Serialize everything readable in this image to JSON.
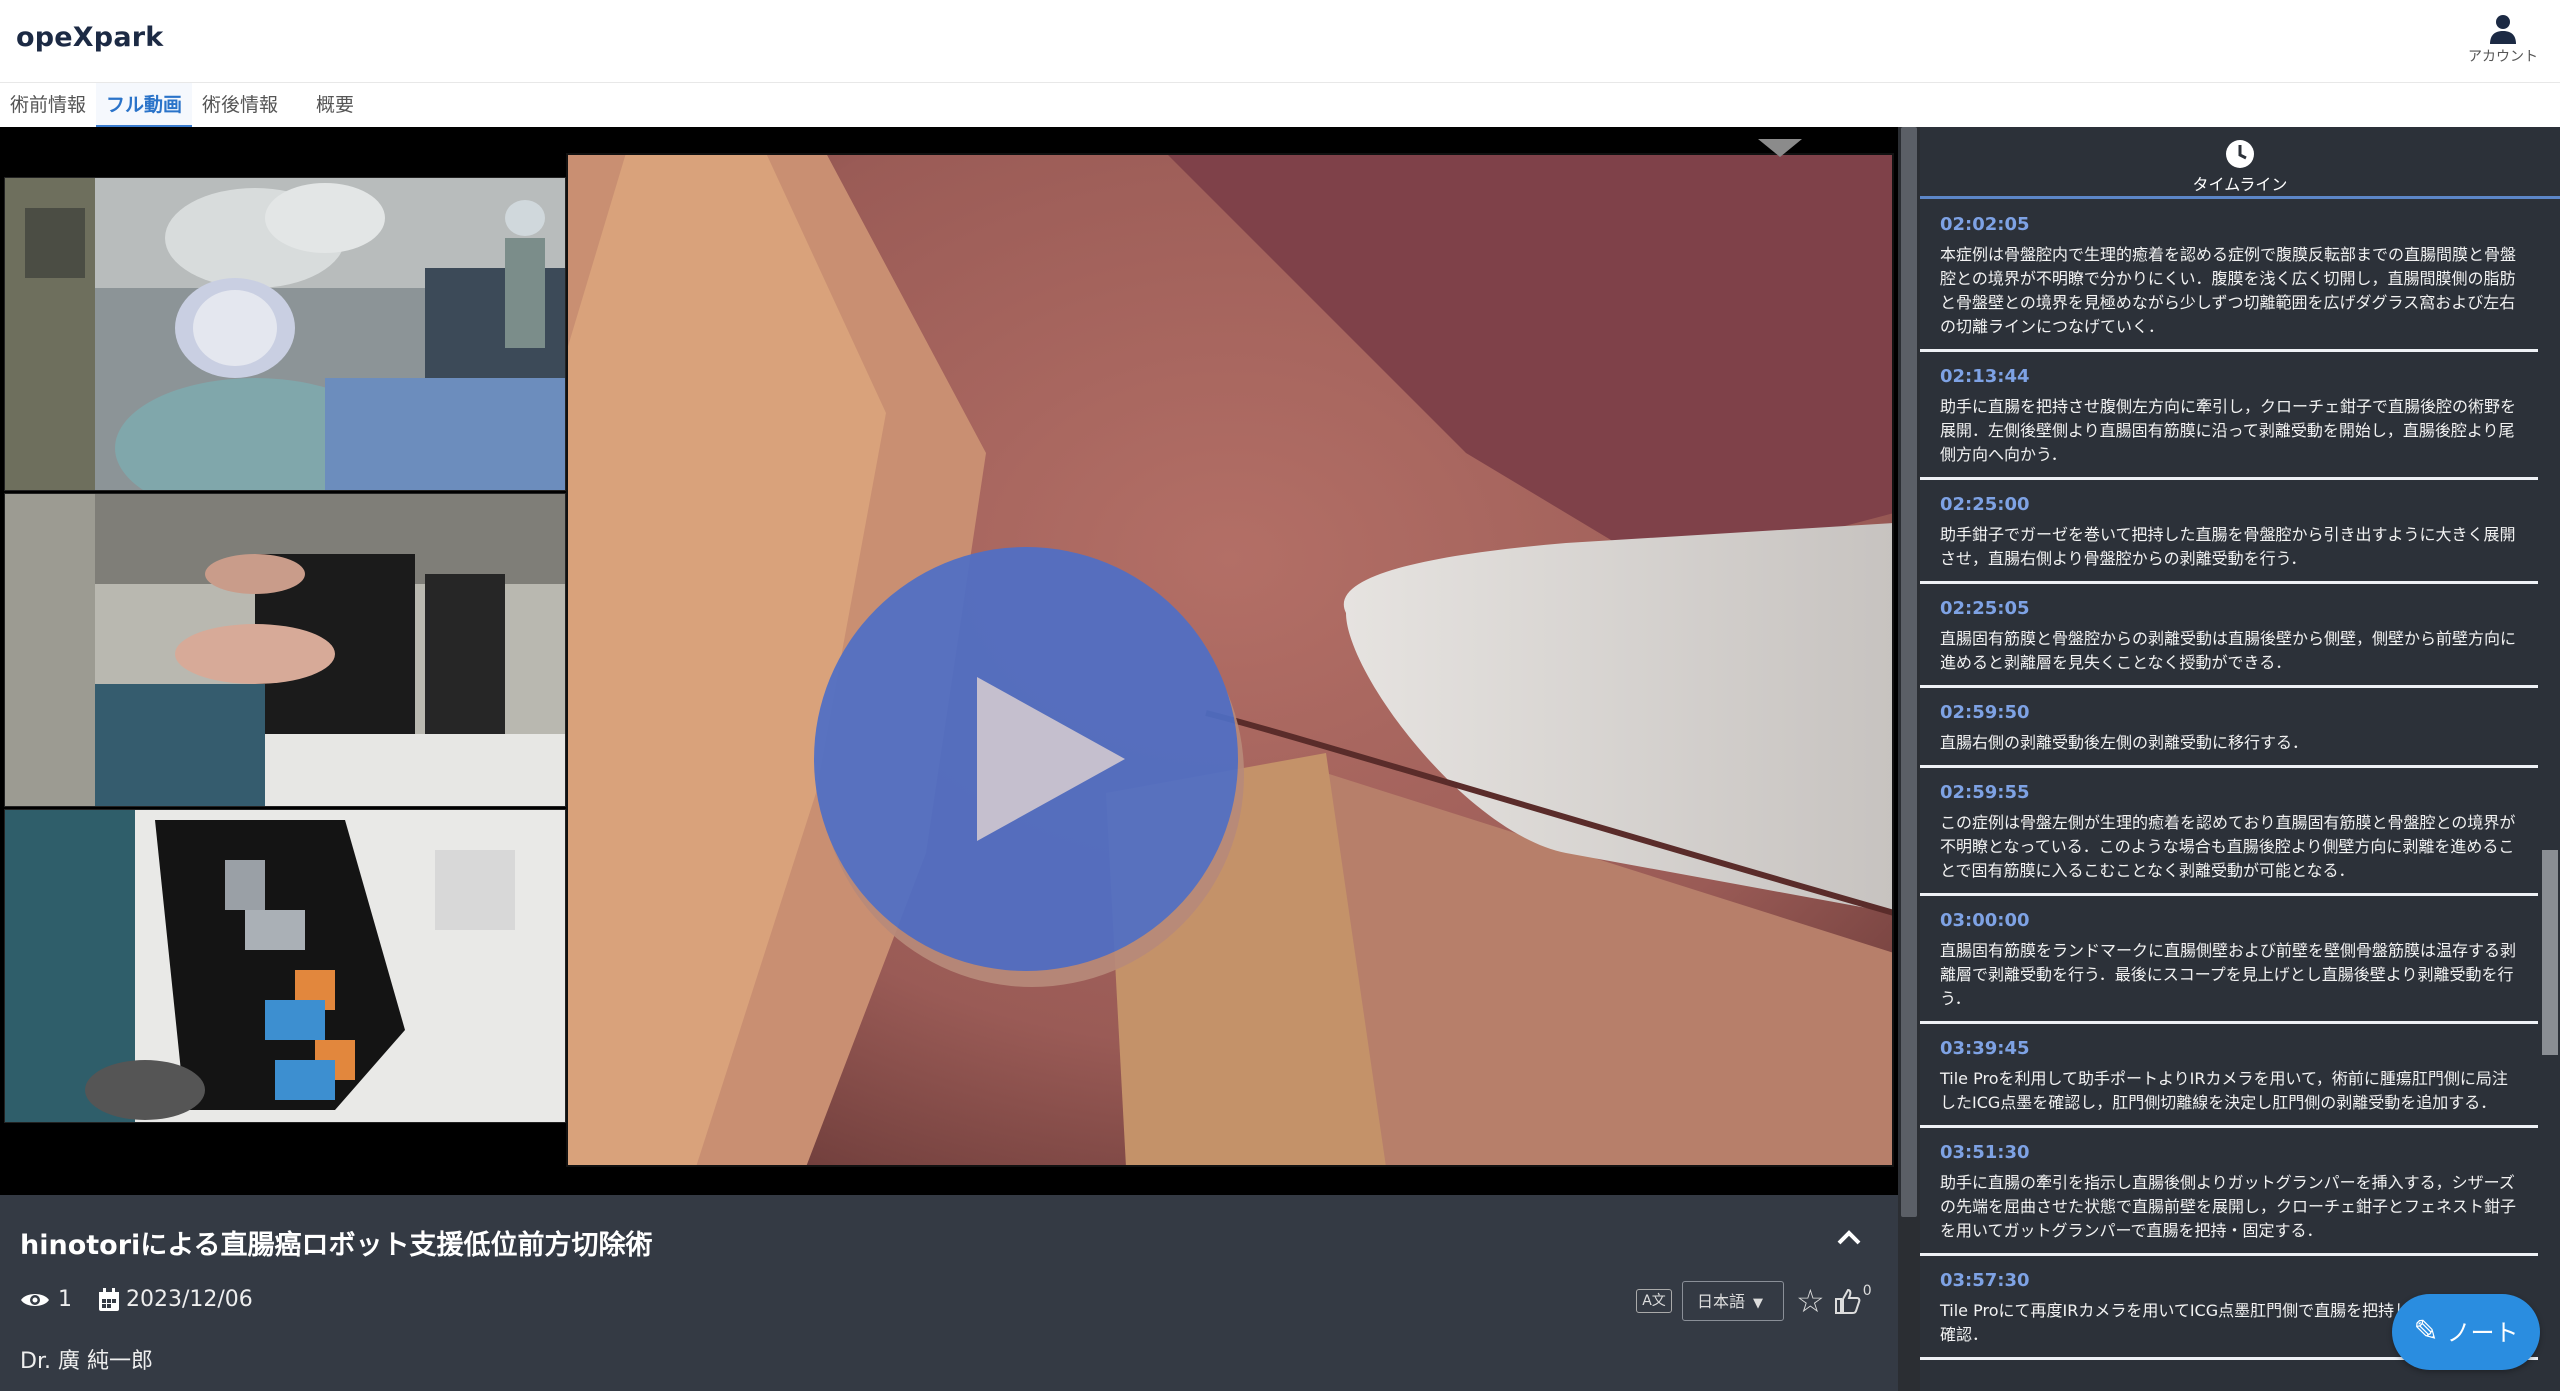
{
  "header": {
    "logo": "opeXpark",
    "account_label": "アカウント"
  },
  "tabs": [
    {
      "label": "術前情報",
      "active": false
    },
    {
      "label": "フル動画",
      "active": true
    },
    {
      "label": "術後情報",
      "active": false
    },
    {
      "label": "概要",
      "active": false
    }
  ],
  "video": {
    "title": "hinotoriによる直腸癌ロボット支援低位前方切除術",
    "views": "1",
    "date": "2023/12/06",
    "doctor": "Dr. 廣 純一郎",
    "language": "日本語",
    "translate_label": "A文",
    "likes": "0"
  },
  "timeline": {
    "title": "タイムライン",
    "items": [
      {
        "time": "02:02:05",
        "text": "本症例は骨盤腔内で生理的癒着を認める症例で腹膜反転部までの直腸間膜と骨盤腔との境界が不明瞭で分かりにくい．腹膜を浅く広く切開し，直腸間膜側の脂肪と骨盤壁との境界を見極めながら少しずつ切離範囲を広げダグラス窩および左右の切離ラインにつなげていく．"
      },
      {
        "time": "02:13:44",
        "text": "助手に直腸を把持させ腹側左方向に牽引し，クローチェ鉗子で直腸後腔の術野を展開．左側後壁側より直腸固有筋膜に沿って剥離受動を開始し，直腸後腔より尾側方向へ向かう．"
      },
      {
        "time": "02:25:00",
        "text": "助手鉗子でガーゼを巻いて把持した直腸を骨盤腔から引き出すように大きく展開させ，直腸右側より骨盤腔からの剥離受動を行う．"
      },
      {
        "time": "02:25:05",
        "text": "直腸固有筋膜と骨盤腔からの剥離受動は直腸後壁から側壁，側壁から前壁方向に進めると剥離層を見失くことなく授動ができる．"
      },
      {
        "time": "02:59:50",
        "text": "直腸右側の剥離受動後左側の剥離受動に移行する．"
      },
      {
        "time": "02:59:55",
        "text": "この症例は骨盤左側が生理的癒着を認めており直腸固有筋膜と骨盤腔との境界が不明瞭となっている．このような場合も直腸後腔より側壁方向に剥離を進めることで固有筋膜に入るこむことなく剥離受動が可能となる．"
      },
      {
        "time": "03:00:00",
        "text": "直腸固有筋膜をランドマークに直腸側壁および前壁を壁側骨盤筋膜は温存する剥離層で剥離受動を行う．最後にスコープを見上げとし直腸後壁より剥離受動を行う．"
      },
      {
        "time": "03:39:45",
        "text": "Tile Proを利用して助手ポートよりIRカメラを用いて，術前に腫瘍肛門側に局注したICG点墨を確認し，肛門側切離線を決定し肛門側の剥離受動を追加する．"
      },
      {
        "time": "03:51:30",
        "text": "助手に直腸の牽引を指示し直腸後側よりガットグランパーを挿入する，シザーズの先端を屈曲させた状態で直腸前壁を展開し，クローチェ鉗子とフェネスト鉗子を用いてガットグランパーで直腸を把持・固定する．"
      },
      {
        "time": "03:57:30",
        "text": "Tile Proにて再度IRカメラを用いてICG点墨肛門側で直腸を把持していることを確認．"
      }
    ]
  },
  "note_button": {
    "label": "ノート"
  },
  "icons": {
    "account": "account-icon",
    "eye": "eye-icon",
    "calendar": "calendar-icon",
    "star": "star-icon",
    "like": "thumbs-up-icon",
    "clock": "clock-icon",
    "pencil": "pencil-icon",
    "play": "play-icon",
    "collapse": "chevron-up-icon"
  },
  "colors": {
    "accent": "#3b7dd0",
    "timeline_time": "#7ea2e4",
    "note_button": "#2a8de0",
    "play_button": "#4f6fc6"
  }
}
